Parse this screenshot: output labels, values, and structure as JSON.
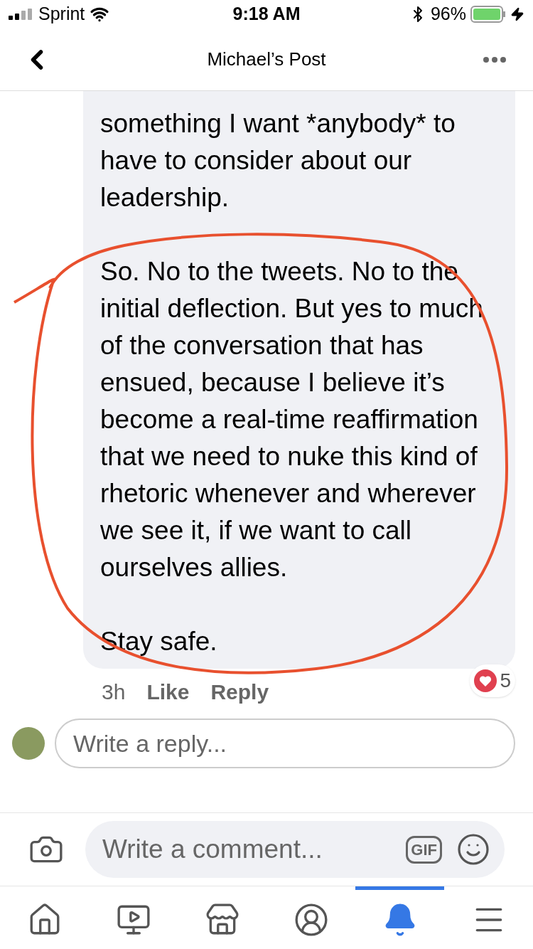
{
  "status_bar": {
    "carrier": "Sprint",
    "time": "9:18 AM",
    "battery": "96%"
  },
  "header": {
    "title": "Michael’s Post"
  },
  "comment": {
    "paragraphs": [
      "something I want *anybody* to have to consider about our leadership.",
      "So. No to the tweets. No to the initial deflection. But yes to much of the conversation that has ensued, because I believe it’s become a real-time reaffirmation that we need to nuke this kind of rhetoric whenever and wherever we see it, if we want to call ourselves allies.",
      "Stay safe."
    ],
    "time": "3h",
    "like": "Like",
    "reply": "Reply",
    "reaction_count": "5"
  },
  "reply_field": {
    "placeholder": "Write a reply..."
  },
  "comment_bar": {
    "placeholder": "Write a comment...",
    "gif": "GIF"
  },
  "tabs": [
    {
      "kind": "home",
      "selected": false
    },
    {
      "kind": "video",
      "selected": false
    },
    {
      "kind": "store",
      "selected": false
    },
    {
      "kind": "profile",
      "selected": false
    },
    {
      "kind": "bell",
      "selected": true
    },
    {
      "kind": "menu",
      "selected": false
    }
  ]
}
